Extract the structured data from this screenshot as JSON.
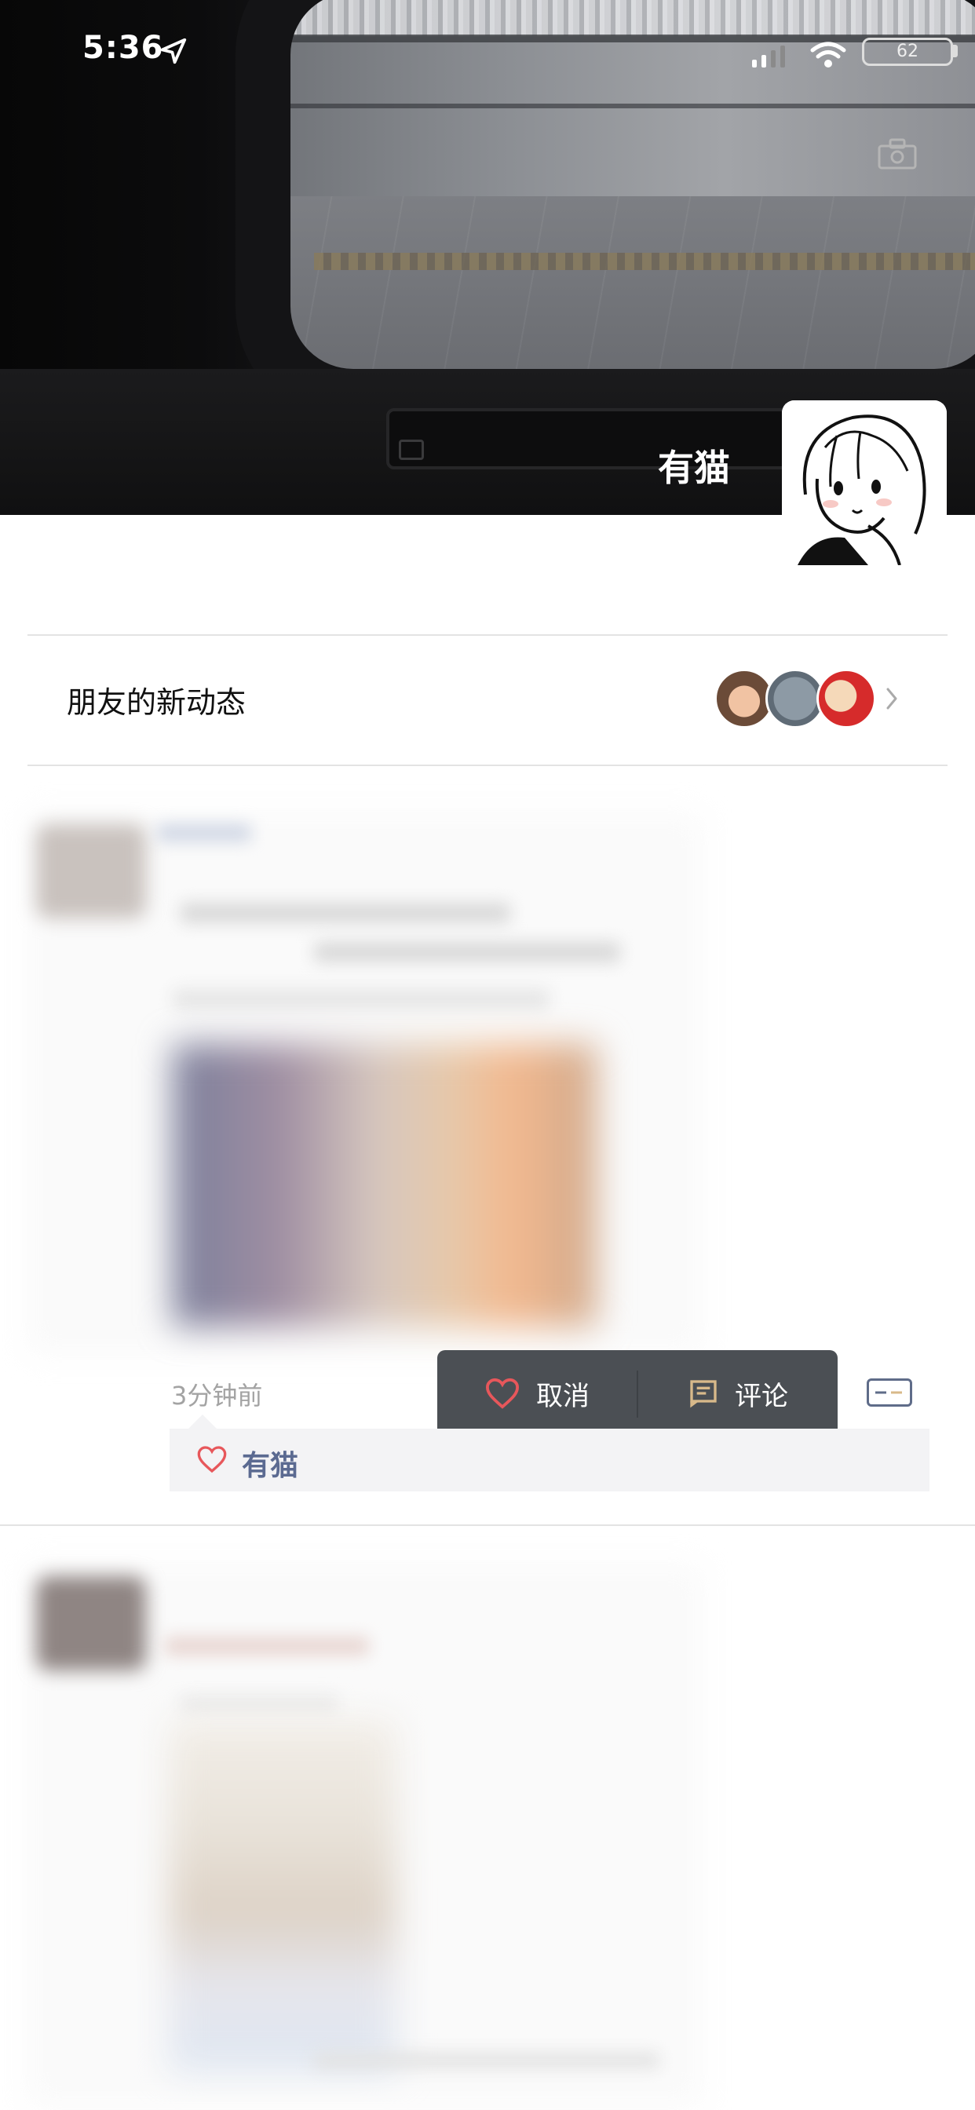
{
  "status_bar": {
    "time": "5:36",
    "battery": "62"
  },
  "cover": {
    "profile_name": "有猫"
  },
  "friends_updates": {
    "label": "朋友的新动态"
  },
  "post1": {
    "time": "3分钟前",
    "action_like_label": "取消",
    "action_comment_label": "评论",
    "liked_by": "有猫"
  },
  "colors": {
    "link_blue": "#5b6a91",
    "popup_bg": "#4b4f54",
    "heart_red": "#e7575b",
    "comment_icon": "#d8b98a"
  },
  "icons": [
    "location-arrow-icon",
    "signal-icon",
    "wifi-icon",
    "battery-icon",
    "camera-icon",
    "chevron-right-icon",
    "heart-icon",
    "comment-icon",
    "more-icon"
  ]
}
